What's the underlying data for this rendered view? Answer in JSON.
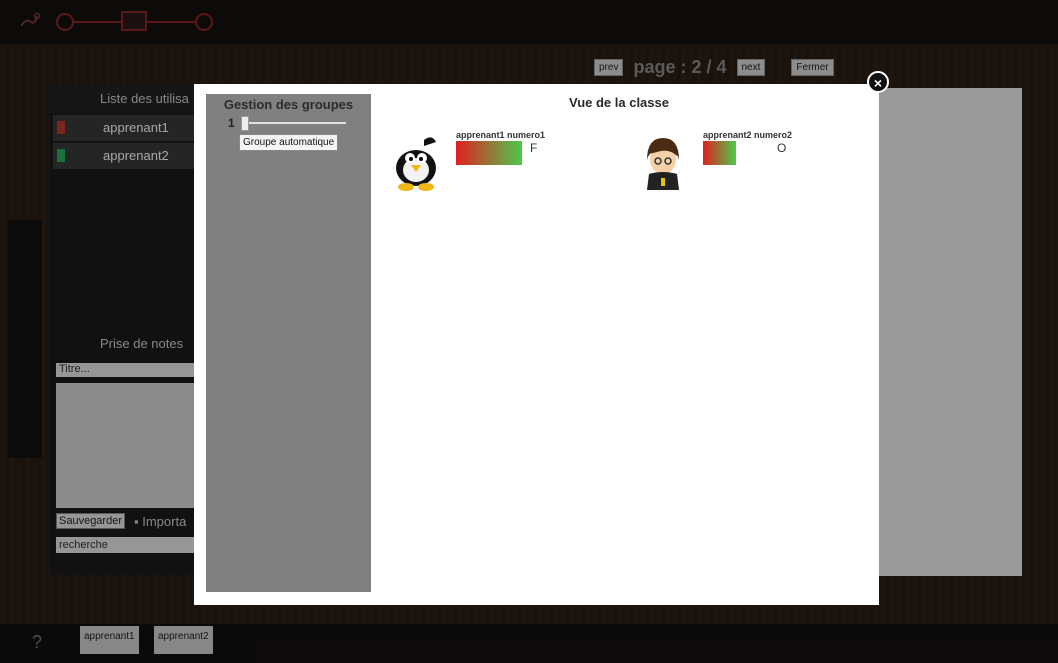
{
  "page_nav": {
    "prev": "prev",
    "label": "page : 2 / 4",
    "next": "next",
    "close": "Fermer"
  },
  "user_panel": {
    "header": "Liste des utilisa",
    "users": [
      {
        "name": "apprenant1",
        "flag_color": "#c0392b"
      },
      {
        "name": "apprenant2",
        "flag_color": "#27ae60"
      }
    ]
  },
  "notes": {
    "header": "Prise de notes",
    "title_placeholder": "Titre...",
    "save_label": "Sauvegarder",
    "important_label": "Importa",
    "search_placeholder": "recherche"
  },
  "bottom_bar": {
    "help_icon": "?",
    "tabs": [
      "apprenant1",
      "apprenant2"
    ]
  },
  "modal": {
    "close_icon": "×",
    "groups": {
      "title": "Gestion des groupes",
      "slider_value": "1",
      "auto_button": "Groupe automatique"
    },
    "class_title": "Vue de la classe",
    "students": [
      {
        "name": "apprenant1 numero1",
        "grade": "F",
        "avatar": "penguin-avatar",
        "gauge_fraction": 1.0
      },
      {
        "name": "apprenant2 numero2",
        "grade": "O",
        "avatar": "boy-avatar",
        "gauge_fraction": 0.5
      }
    ]
  },
  "colors": {
    "accent_red": "#8b2626",
    "gauge_start": "#e02020",
    "gauge_end": "#4cc94c"
  }
}
